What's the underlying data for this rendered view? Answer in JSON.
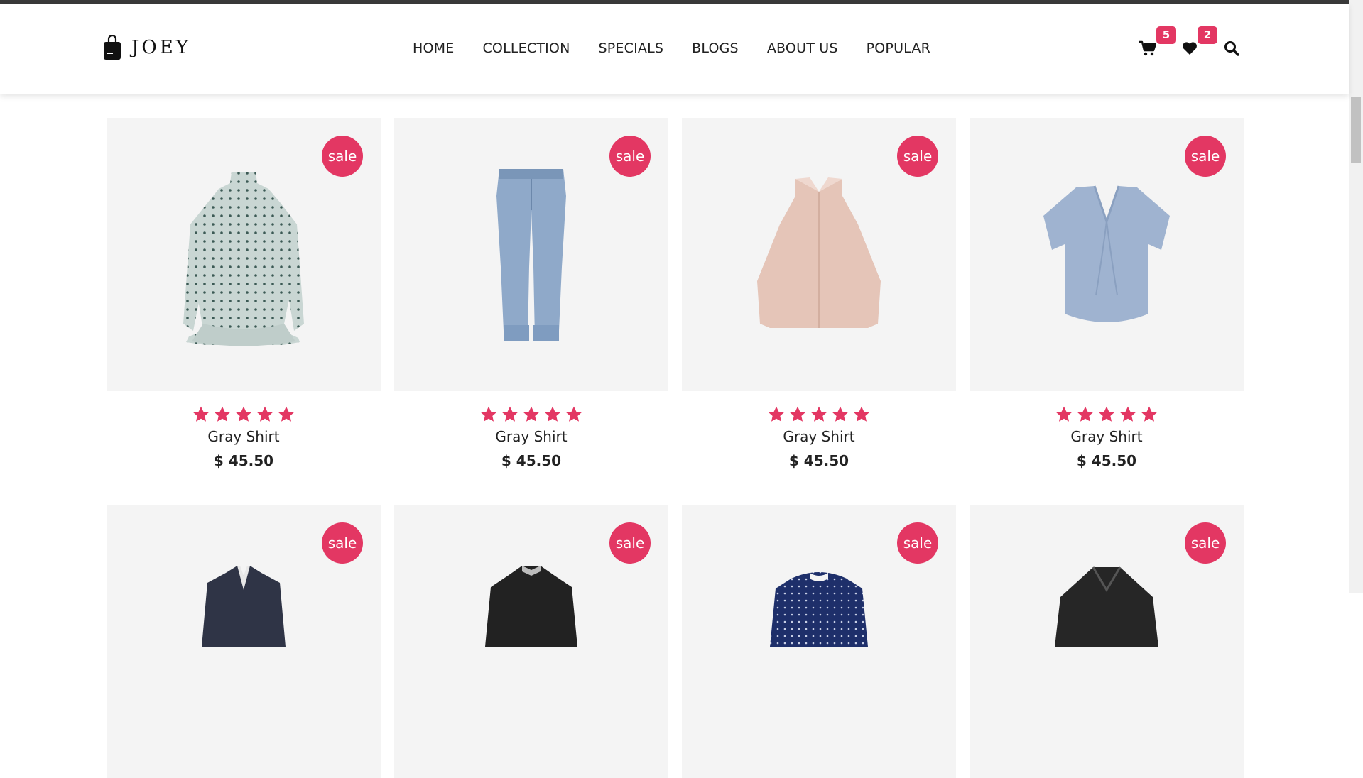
{
  "brand": {
    "name": "JOEY"
  },
  "nav": [
    "HOME",
    "COLLECTION",
    "SPECIALS",
    "BLOGS",
    "ABOUT US",
    "POPULAR"
  ],
  "header_icons": {
    "cart": {
      "icon": "cart-icon",
      "count": "5"
    },
    "wishlist": {
      "icon": "heart-icon",
      "count": "2"
    },
    "search": {
      "icon": "search-icon"
    }
  },
  "colors": {
    "accent": "#e33763",
    "card_bg": "#f4f4f4",
    "text": "#222222"
  },
  "products": [
    {
      "name": "Gray Shirt",
      "price": "$ 45.50",
      "badge": "sale",
      "rating": 5,
      "image": "polka-dot-dress"
    },
    {
      "name": "Gray Shirt",
      "price": "$ 45.50",
      "badge": "sale",
      "rating": 5,
      "image": "blue-jeans"
    },
    {
      "name": "Gray Shirt",
      "price": "$ 45.50",
      "badge": "sale",
      "rating": 5,
      "image": "beige-halter-top"
    },
    {
      "name": "Gray Shirt",
      "price": "$ 45.50",
      "badge": "sale",
      "rating": 5,
      "image": "blue-tshirt"
    },
    {
      "name": "",
      "price": "",
      "badge": "sale",
      "rating": 0,
      "image": "navy-blazer"
    },
    {
      "name": "",
      "price": "",
      "badge": "sale",
      "rating": 0,
      "image": "black-jacket"
    },
    {
      "name": "",
      "price": "",
      "badge": "sale",
      "rating": 0,
      "image": "navy-dotted-top"
    },
    {
      "name": "",
      "price": "",
      "badge": "sale",
      "rating": 0,
      "image": "black-leather-jacket"
    }
  ]
}
